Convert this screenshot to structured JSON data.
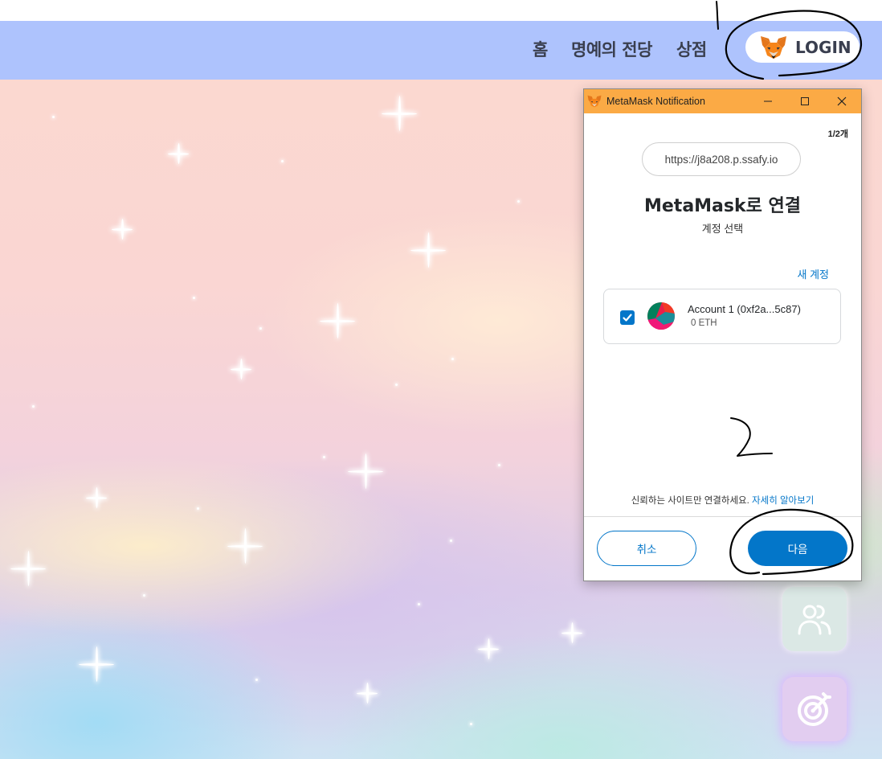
{
  "nav": {
    "items": [
      {
        "label": "홈"
      },
      {
        "label": "명예의 전당"
      },
      {
        "label": "상점"
      }
    ],
    "login_label": "LOGIN"
  },
  "metamask": {
    "window_title": "MetaMask Notification",
    "pager": "1/2개",
    "site_url": "https://j8a208.p.ssafy.io",
    "heading": "MetaMask로 연결",
    "subheading": "계정 선택",
    "new_account_label": "새 계정",
    "account": {
      "name": "Account 1 (0xf2a...5c87)",
      "balance": "0 ETH",
      "checked": true
    },
    "trust_note": "신뢰하는 사이트만 연결하세요.",
    "learn_more": "자세히 알아보기",
    "cancel_label": "취소",
    "next_label": "다음",
    "colors": {
      "titlebar": "#fbaa45",
      "primary": "#0376c9"
    }
  },
  "annotations": {
    "marks": [
      "1",
      "2"
    ]
  },
  "side_buttons": {
    "icons": [
      "users-icon",
      "target-icon"
    ]
  },
  "colors": {
    "navbar": "#aec3fd"
  }
}
